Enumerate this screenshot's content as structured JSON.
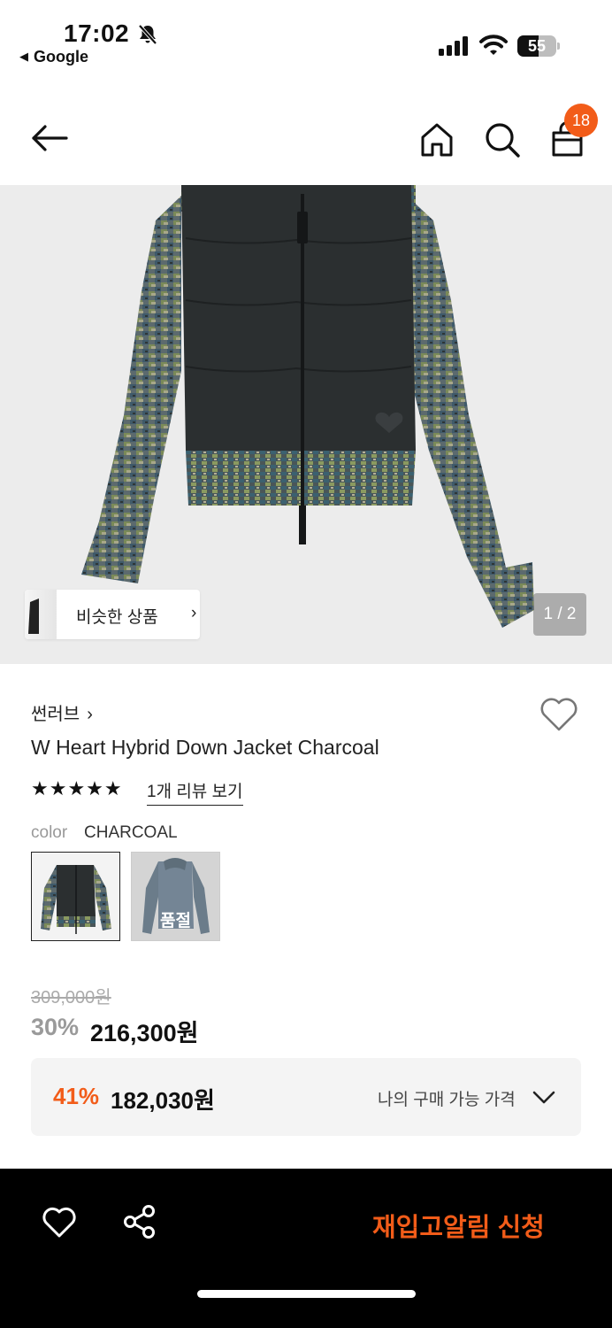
{
  "status_bar": {
    "time": "17:02",
    "back_app": "Google",
    "battery_level": "55",
    "battery_fraction": 0.55,
    "icons": [
      "bell-slash-icon",
      "signal-icon",
      "wifi-icon",
      "battery-icon"
    ]
  },
  "nav": {
    "icons": [
      "back-arrow-icon",
      "home-icon",
      "search-icon",
      "shopping-bag-icon"
    ],
    "cart_count": "18"
  },
  "hero": {
    "similar_label": "비슷한 상품",
    "similar_chevron": "›",
    "page_counter": "1 / 2"
  },
  "product": {
    "brand": "썬러브",
    "brand_chevron": "›",
    "title": "W Heart Hybrid Down Jacket Charcoal",
    "stars": "★★★★★",
    "rating": 5,
    "review_link": "1개 리뷰 보기",
    "color_label": "color",
    "color_value": "CHARCOAL",
    "soldout_label": "품절",
    "original_price": "309,000원",
    "discount_percent": "30%",
    "sale_price": "216,300원",
    "my_price": {
      "percent": "41%",
      "price": "182,030원",
      "label": "나의 구매 가능 가격"
    }
  },
  "bottom_bar": {
    "restock_label": "재입고알림 신청",
    "icons": [
      "heart-icon",
      "share-icon"
    ]
  },
  "colors": {
    "accent": "#f25c19",
    "bar": "#000000",
    "hero_bg": "#ececec"
  }
}
